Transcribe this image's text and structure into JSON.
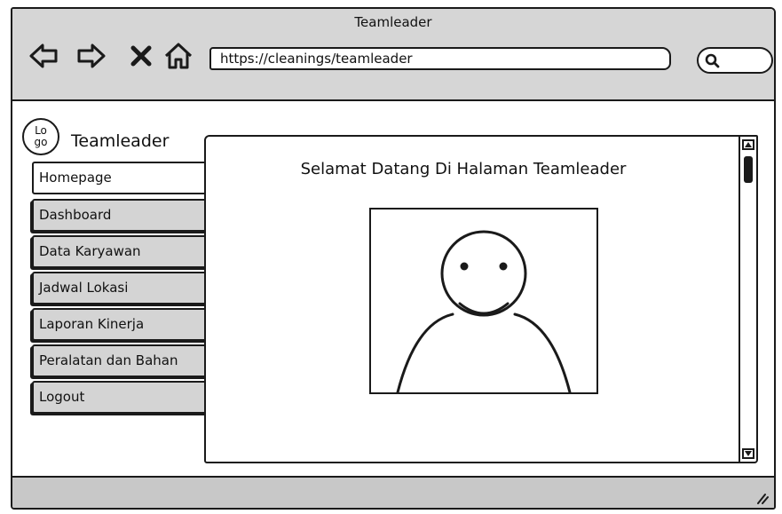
{
  "window": {
    "title": "Teamleader"
  },
  "toolbar": {
    "url": "https://cleanings/teamleader"
  },
  "icons": {
    "back": "back-arrow-icon",
    "forward": "forward-arrow-icon",
    "stop": "close-x-icon",
    "home": "home-icon",
    "search": "search-icon",
    "resize": "resize-grip-icon"
  },
  "header": {
    "logo_text_1": "Lo",
    "logo_text_2": "go",
    "app_title": "Teamleader"
  },
  "sidebar": {
    "items": [
      {
        "label": "Homepage",
        "active": true
      },
      {
        "label": "Dashboard",
        "active": false
      },
      {
        "label": "Data Karyawan",
        "active": false
      },
      {
        "label": "Jadwal Lokasi",
        "active": false
      },
      {
        "label": "Laporan Kinerja",
        "active": false
      },
      {
        "label": "Peralatan dan Bahan",
        "active": false
      },
      {
        "label": "Logout",
        "active": false
      }
    ]
  },
  "main": {
    "welcome_text": "Selamat Datang Di Halaman Teamleader"
  },
  "colors": {
    "chrome": "#d6d6d6",
    "tab_inactive": "#d4d4d4",
    "outline": "#1a1a1a",
    "background": "#ffffff"
  }
}
